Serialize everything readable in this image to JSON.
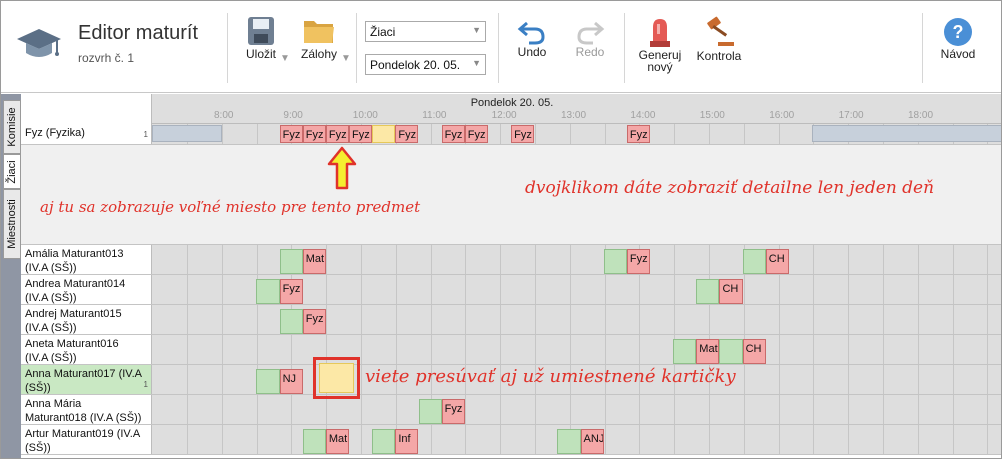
{
  "app": {
    "title": "Editor maturít",
    "subtitle": "rozvrh č. 1"
  },
  "toolbar": {
    "save_label": "Uložit",
    "backups_label": "Zálohy",
    "view_select": "Žiaci",
    "day_select": "Pondelok 20. 05.",
    "undo_label": "Undo",
    "redo_label": "Redo",
    "generate_label_1": "Generuj",
    "generate_label_2": "nový",
    "check_label": "Kontrola",
    "help_label": "Návod"
  },
  "tabs": [
    {
      "label": "Komisie",
      "active": false
    },
    {
      "label": "Žiaci",
      "active": true
    },
    {
      "label": "Miestnosti",
      "active": false
    }
  ],
  "header": {
    "day": "Pondelok 20. 05.",
    "hours": [
      "8:00",
      "9:00",
      "10:00",
      "11:00",
      "12:00",
      "13:00",
      "14:00",
      "15:00",
      "16:00",
      "17:00",
      "18:00"
    ]
  },
  "subject_row": {
    "label": "Fyz (Fyzika)",
    "count": "1",
    "cards": [
      {
        "text": "Fyz",
        "slot": 4,
        "kind": "red"
      },
      {
        "text": "Fyz",
        "slot": 5,
        "kind": "red"
      },
      {
        "text": "Fyz",
        "slot": 6,
        "kind": "red"
      },
      {
        "text": "Fyz",
        "slot": 7,
        "kind": "red"
      },
      {
        "text": "",
        "slot": 8,
        "kind": "yel"
      },
      {
        "text": "Fyz",
        "slot": 9,
        "kind": "red"
      },
      {
        "text": "Fyz",
        "slot": 11,
        "kind": "red"
      },
      {
        "text": "Fyz",
        "slot": 12,
        "kind": "red"
      },
      {
        "text": "Fyz",
        "slot": 14,
        "kind": "red"
      },
      {
        "text": "Fyz",
        "slot": 19,
        "kind": "red"
      }
    ]
  },
  "annotations": {
    "free_place": "aj tu sa zobrazuje voľné miesto pre tento predmet",
    "double_click": "dvojklikom dáte zobraziť detailne len jeden deň",
    "move_cards": "viete presúvať aj už umiestnené kartičky"
  },
  "students": [
    {
      "name": "Amália Maturant013",
      "class": "(IV.A (SŠ))",
      "cards": [
        {
          "text": "Mat",
          "g": 4,
          "r": 5
        },
        {
          "text": "Fyz",
          "g": 18,
          "r": 19
        },
        {
          "text": "CH",
          "g": 24,
          "r": 25
        }
      ]
    },
    {
      "name": "Andrea Maturant014",
      "class": "(IV.A (SŠ))",
      "cards": [
        {
          "text": "Fyz",
          "g": 3,
          "r": 4
        },
        {
          "text": "CH",
          "g": 22,
          "r": 23
        }
      ]
    },
    {
      "name": "Andrej Maturant015",
      "class": "(IV.A (SŠ))",
      "cards": [
        {
          "text": "Fyz",
          "g": 4,
          "r": 5
        }
      ]
    },
    {
      "name": "Aneta Maturant016",
      "class": "(IV.A (SŠ))",
      "cards": [
        {
          "text": "Mat",
          "g": 21,
          "r": 22
        },
        {
          "text": "CH",
          "g": 23,
          "r": 24
        }
      ]
    },
    {
      "name": "Anna Maturant017 (IV.A",
      "class": "(SŠ))",
      "selected": true,
      "count": "1",
      "cards": [
        {
          "text": "NJ",
          "g": 3,
          "r": 4
        }
      ]
    },
    {
      "name": "Anna Mária",
      "class": "Maturant018 (IV.A (SŠ))",
      "cards": [
        {
          "text": "Fyz",
          "g": 10,
          "r": 11
        }
      ]
    },
    {
      "name": "Artur Maturant019 (IV.A",
      "class": "(SŠ))",
      "cards": [
        {
          "text": "Mat",
          "g": 5,
          "r": 6
        },
        {
          "text": "Inf",
          "g": 8,
          "r": 9
        },
        {
          "text": "ANJ",
          "g": 16,
          "r": 17
        }
      ]
    }
  ]
}
